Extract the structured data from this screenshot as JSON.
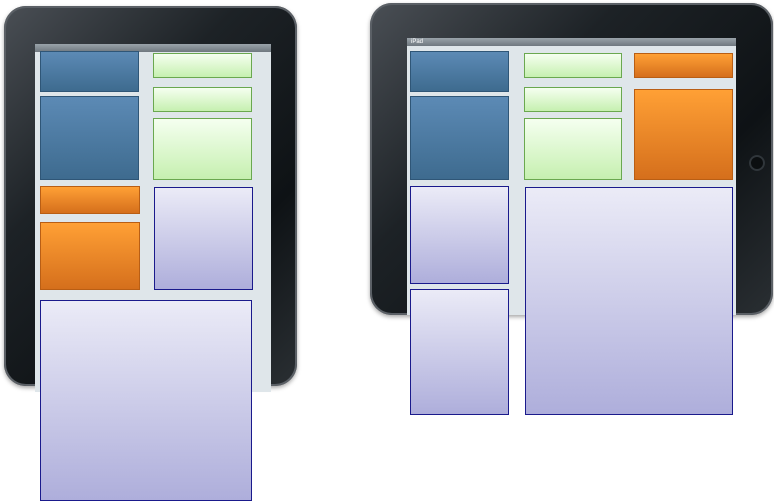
{
  "portrait_device": {
    "status": {
      "left": "",
      "center": "",
      "right": ""
    }
  },
  "landscape_device": {
    "status": {
      "left": "iPad",
      "center": "",
      "right": ""
    }
  },
  "colors": {
    "blue": "#4f7ca6",
    "green": "#d8f5c8",
    "orange": "#f08a28",
    "lavender": "#cfcfea",
    "outline": "#1a1a8c"
  }
}
